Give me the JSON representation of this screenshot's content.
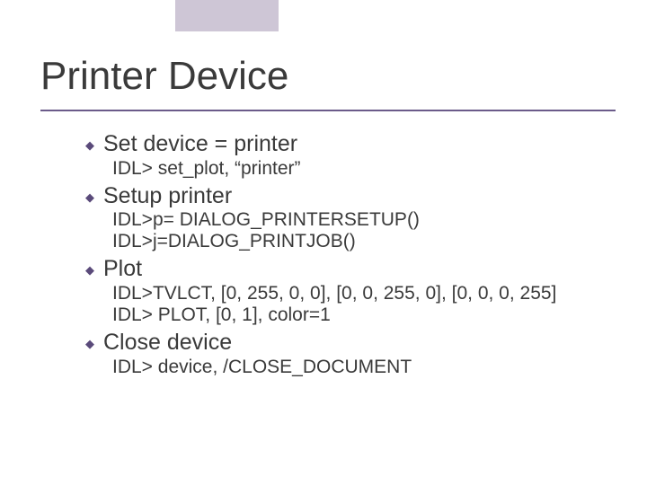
{
  "slide": {
    "title": "Printer Device",
    "items": [
      {
        "label": "Set device = printer",
        "sub": [
          "IDL> set_plot, “printer”"
        ]
      },
      {
        "label": "Setup printer",
        "sub": [
          "IDL>p= DIALOG_PRINTERSETUP()",
          "IDL>j=DIALOG_PRINTJOB()"
        ]
      },
      {
        "label": "Plot",
        "sub": [
          "IDL>TVLCT, [0, 255, 0, 0], [0, 0, 255, 0], [0, 0, 0, 255]",
          "IDL> PLOT, [0, 1], color=1"
        ]
      },
      {
        "label": "Close device",
        "sub": [
          "IDL> device, /CLOSE_DOCUMENT"
        ]
      }
    ]
  }
}
